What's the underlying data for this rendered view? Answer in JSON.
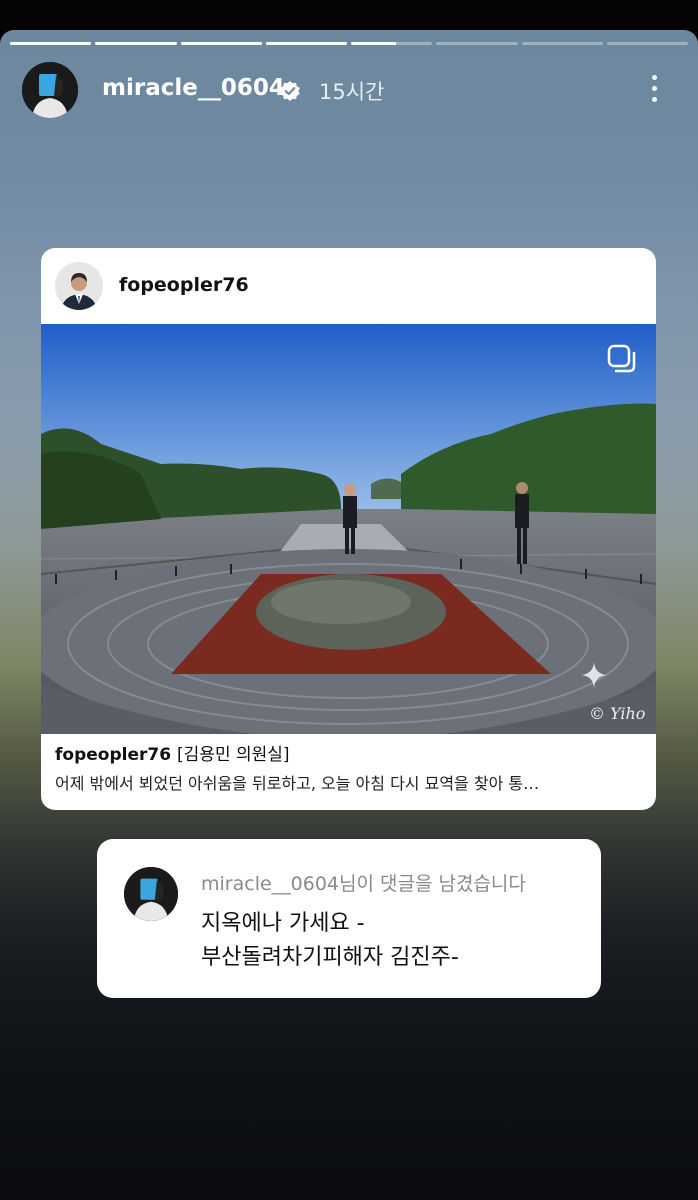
{
  "story": {
    "progress": {
      "segment_count": 8,
      "fills": [
        1,
        1,
        1,
        1,
        0.55,
        0,
        0,
        0
      ]
    },
    "header": {
      "username": "miracle__0604",
      "verified": true,
      "time": "15시간"
    }
  },
  "shared_post": {
    "username": "fopeopler76",
    "caption_tag": "[김용민 의원실]",
    "caption_text": "어제 밖에서 뵈었던 아쉬움을 뒤로하고, 오늘 아침 다시 묘역을 찾아 통…",
    "watermark": "© Yiho"
  },
  "comment": {
    "author": "miracle__0604",
    "meta_suffix": "님이 댓글을 남겼습니다",
    "text": "지옥에나 가세요 -\n부산돌려차기피해자 김진주-"
  },
  "colors": {
    "verified_badge": "#ffffff",
    "text_dark": "#111111",
    "meta_gray": "#8a8a8a"
  }
}
